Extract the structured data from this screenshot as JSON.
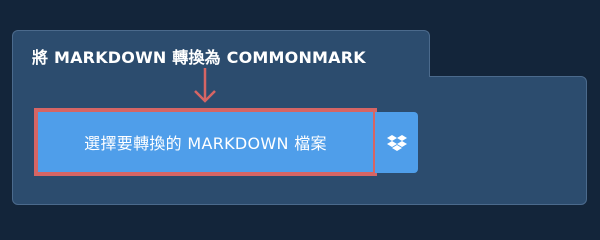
{
  "panel": {
    "title": "將 MARKDOWN 轉換為 COMMONMARK"
  },
  "choose_file": {
    "label": "選擇要轉換的 MARKDOWN 檔案"
  },
  "dropbox": {
    "icon": "dropbox-icon"
  },
  "colors": {
    "background": "#13253a",
    "panel": "#2c4c6e",
    "button": "#4f9eea",
    "highlight": "#d66564"
  }
}
